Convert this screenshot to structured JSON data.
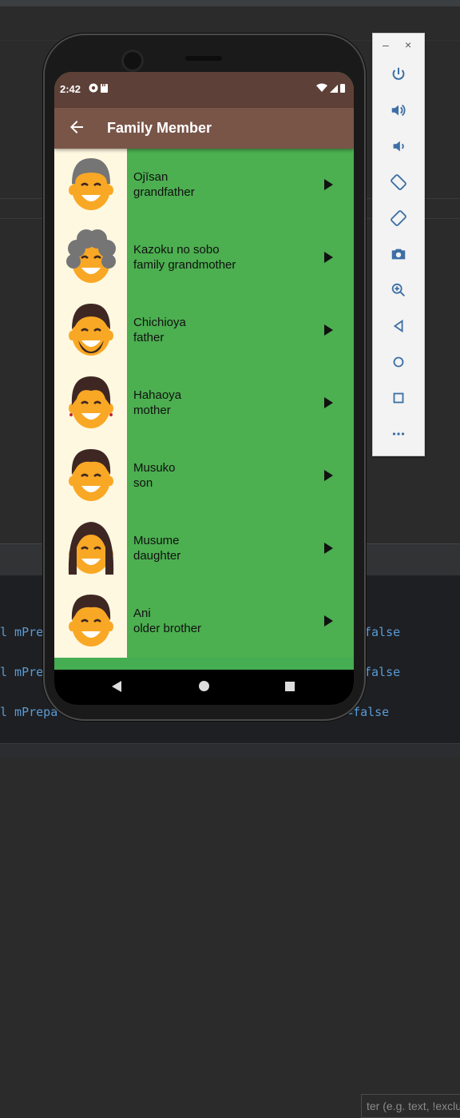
{
  "status_bar": {
    "time": "2:42"
  },
  "app_bar": {
    "title": "Family Member"
  },
  "members": [
    {
      "romaji": "Ojīsan",
      "english": "grandfather",
      "hair": "#757575",
      "style": "bald"
    },
    {
      "romaji": "Kazoku no sobo",
      "english": "family grandmother",
      "hair": "#757575",
      "style": "curly"
    },
    {
      "romaji": "Chichioya",
      "english": "father",
      "hair": "#3e2723",
      "style": "beard"
    },
    {
      "romaji": "Hahaoya",
      "english": "mother",
      "hair": "#3e2723",
      "style": "bun"
    },
    {
      "romaji": "Musuko",
      "english": "son",
      "hair": "#3e2723",
      "style": "short"
    },
    {
      "romaji": "Musume",
      "english": "daughter",
      "hair": "#3e2723",
      "style": "long"
    },
    {
      "romaji": "Ani",
      "english": "older brother",
      "hair": "#3e2723",
      "style": "short"
    }
  ],
  "ide": {
    "filter_placeholder": "ter (e.g. text, !exclu",
    "log_lines": [
      {
        "left": "l mPre",
        "right": "false"
      },
      {
        "left": "l mPre",
        "right": "false"
      },
      {
        "left": "l mPrepa",
        "right": "e=false"
      }
    ]
  },
  "emulator_toolbar": {
    "minimize": "–",
    "close": "×",
    "buttons": [
      "power-icon",
      "volume-up-icon",
      "volume-down-icon",
      "rotate-left-icon",
      "rotate-right-icon",
      "camera-icon",
      "zoom-icon",
      "back-icon",
      "home-icon",
      "overview-icon",
      "more-icon"
    ]
  },
  "colors": {
    "status_bar": "#5d4037",
    "app_bar": "#795548",
    "list_background": "#4caf50",
    "thumb_background": "#fff8e1",
    "face": "#f9a825"
  }
}
